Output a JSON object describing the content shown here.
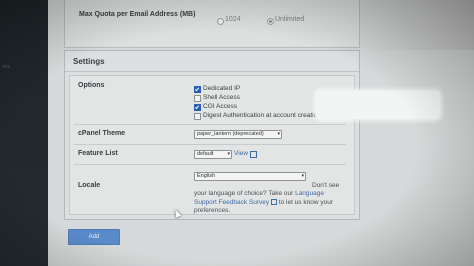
{
  "quota": {
    "label": "Max Quota per Email Address (MB)",
    "options": [
      "1024",
      "Unlimited"
    ],
    "selected": "Unlimited"
  },
  "settings": {
    "title": "Settings",
    "options_label": "Options",
    "options": [
      {
        "label": "Dedicated IP",
        "checked": true
      },
      {
        "label": "Shell Access",
        "checked": false
      },
      {
        "label": "CGI Access",
        "checked": true
      },
      {
        "label": "Digest Authentication at account creation.",
        "checked": false
      }
    ],
    "theme_label": "cPanel Theme",
    "theme_value": "paper_lantern (deprecated)",
    "feature_label": "Feature List",
    "feature_value": "default",
    "feature_view": "View",
    "locale_label": "Locale",
    "locale_value": "English",
    "locale_help_1": "Don't see your language of choice? Take our",
    "locale_help_link": "Language Support Feedback Survey",
    "locale_help_2": "to let us know your preferences."
  },
  "add_button": "Add",
  "colors": {
    "accent": "#5a8ac9",
    "checkbox": "#2b5fb5",
    "link": "#3e6aa8"
  }
}
